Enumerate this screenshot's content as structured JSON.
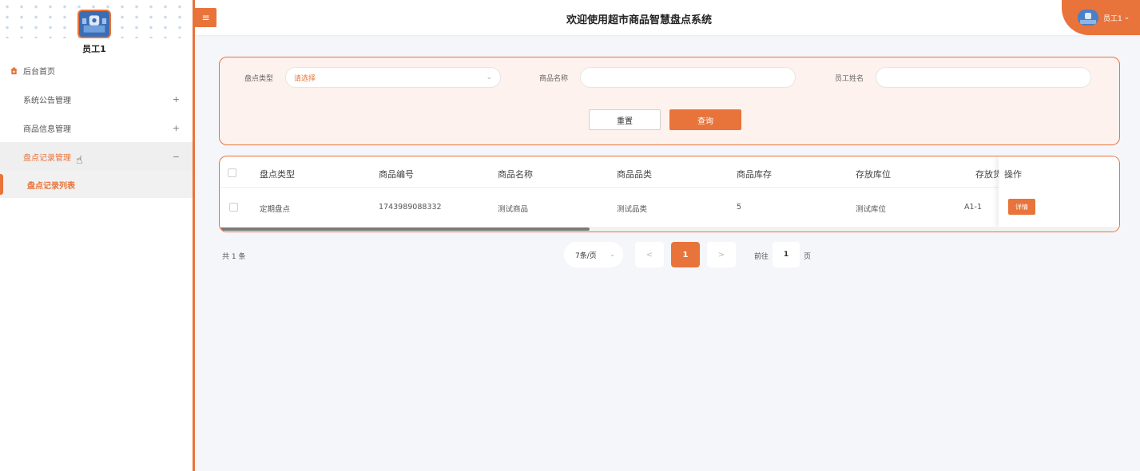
{
  "header": {
    "title": "欢迎使用超市商品智慧盘点系统",
    "menu_toggle": "≡",
    "user_label": "员工1",
    "user_caret": "⌄"
  },
  "sidebar": {
    "username": "员工1",
    "items": [
      {
        "label": "后台首页",
        "icon": "home-icon",
        "sign": ""
      },
      {
        "label": "系统公告管理",
        "icon": "grid-icon",
        "sign": "+"
      },
      {
        "label": "商品信息管理",
        "icon": "grid-icon",
        "sign": "+"
      },
      {
        "label": "盘点记录管理",
        "icon": "grid-icon",
        "sign": "−"
      }
    ],
    "subitems": [
      {
        "label": "盘点记录列表"
      }
    ]
  },
  "search": {
    "fields": [
      {
        "label": "盘点类型",
        "placeholder": "请选择",
        "type": "select"
      },
      {
        "label": "商品名称",
        "value": ""
      },
      {
        "label": "员工姓名",
        "value": ""
      }
    ],
    "reset_label": "重置",
    "query_label": "查询"
  },
  "table": {
    "columns": [
      "盘点类型",
      "商品编号",
      "商品名称",
      "商品品类",
      "商品库存",
      "存放库位",
      "存放货",
      "操作"
    ],
    "rows": [
      [
        "定期盘点",
        "1743989088332",
        "测试商品",
        "测试品类",
        "5",
        "测试库位",
        "A1-1"
      ]
    ],
    "detail_label": "详情"
  },
  "pagination": {
    "total": "共 1 条",
    "page_size": "7条/页",
    "prev": "<",
    "next": ">",
    "current": "1",
    "goto_prefix": "前往",
    "goto_value": "1",
    "goto_suffix": "页"
  },
  "colors": {
    "accent": "#e8743b"
  }
}
